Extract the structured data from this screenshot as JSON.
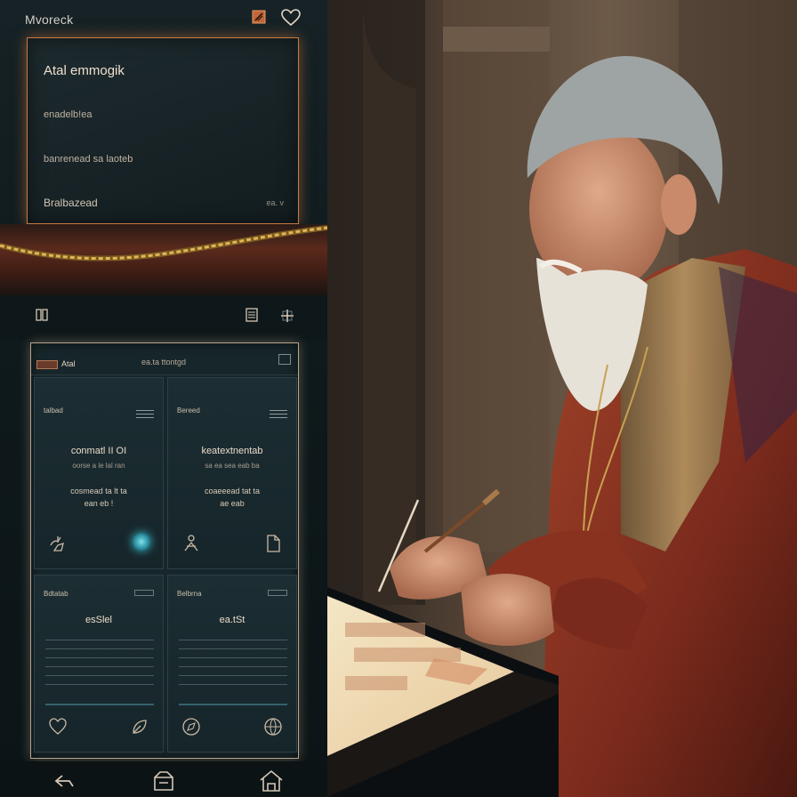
{
  "app": {
    "brand": "Mvoreck"
  },
  "note": {
    "title": "Atal emmogik",
    "line1": "enadelb!ea",
    "line2": "banrenead sa laoteb",
    "line3": "Bralbazead",
    "meta": "ea. v"
  },
  "panel": {
    "tag": "Atal",
    "title": "ea.ta ttontgd",
    "tiles": [
      {
        "label": "talbad",
        "heading": "conmatl II OI",
        "sub1": "oorse a le lal ran",
        "sub2": "cosmead ta lt  ta",
        "sub3": "ean eb !"
      },
      {
        "label": "Bereed",
        "heading": "keatextnentab",
        "sub1": "sa ea sea eab ba",
        "sub2": "coaeeead tat  ta",
        "sub3": "ae eab"
      },
      {
        "label": "Bdtatab",
        "heading": "esSlel",
        "sub1": "",
        "sub2": "",
        "sub3": ""
      },
      {
        "label": "Belbrna",
        "heading": "ea.tSt",
        "sub1": "",
        "sub2": "",
        "sub3": ""
      }
    ]
  },
  "colors": {
    "accent": "#c87a42",
    "glow": "#3fc1d2",
    "panel_border": "#b8a48c"
  },
  "icons": [
    "edit-icon",
    "heart-icon",
    "grid-icon",
    "book-icon",
    "add-icon",
    "back-icon",
    "inbox-icon",
    "home-icon"
  ]
}
